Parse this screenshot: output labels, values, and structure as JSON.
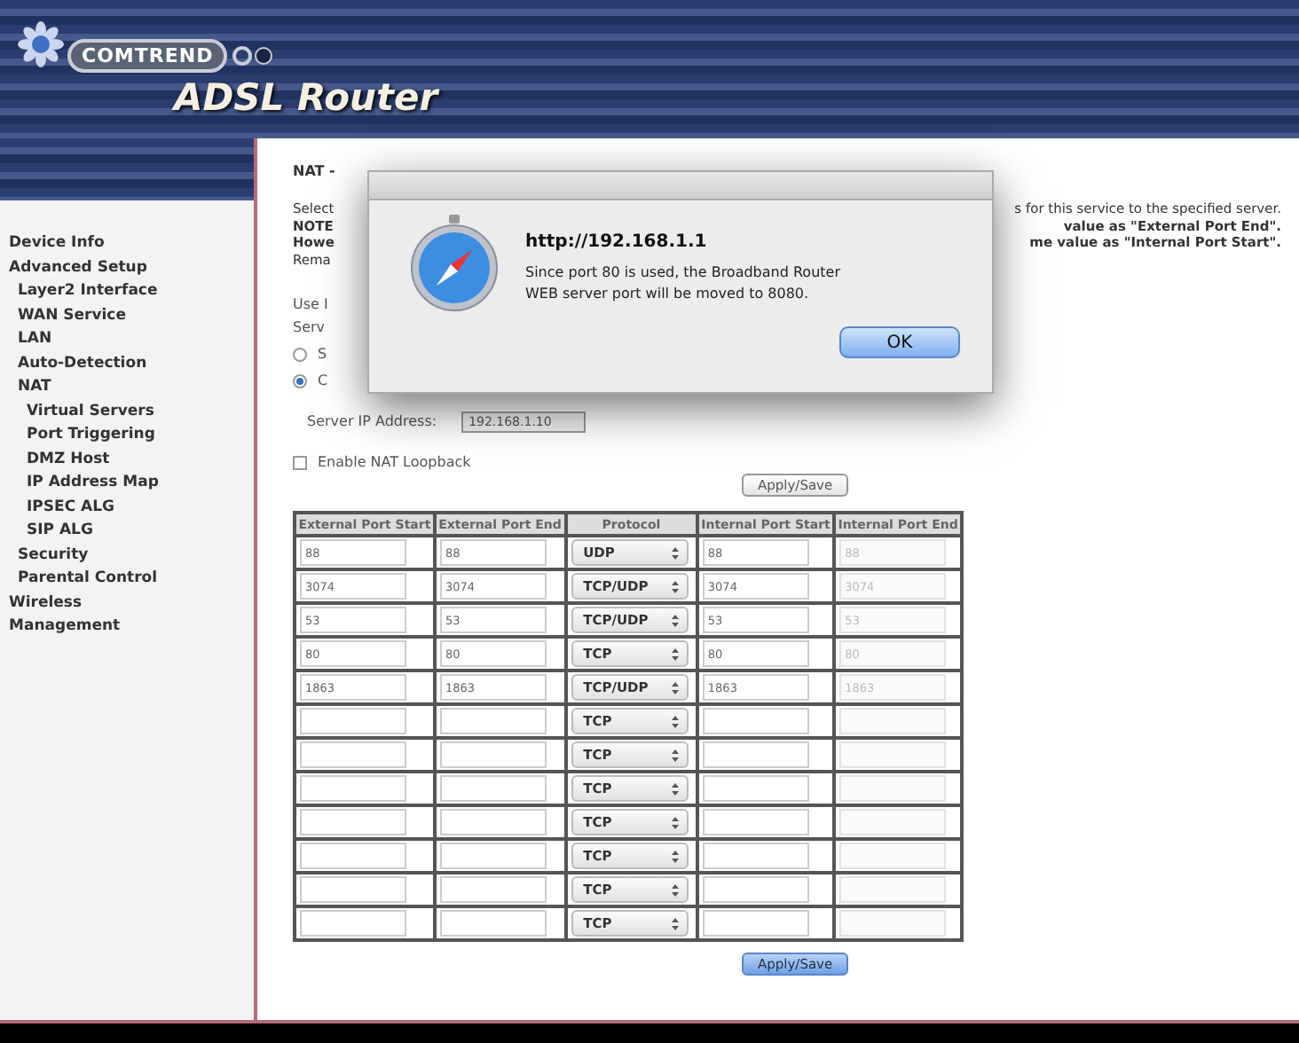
{
  "header": {
    "brand": "COMTREND",
    "product": "ADSL Router"
  },
  "sidebar": {
    "items": [
      {
        "label": "Device Info"
      },
      {
        "label": "Advanced Setup",
        "children": [
          {
            "label": "Layer2 Interface"
          },
          {
            "label": "WAN Service"
          },
          {
            "label": "LAN"
          },
          {
            "label": "Auto-Detection"
          },
          {
            "label": "NAT",
            "children": [
              {
                "label": "Virtual Servers"
              },
              {
                "label": "Port Triggering"
              },
              {
                "label": "DMZ Host"
              },
              {
                "label": "IP Address Map"
              },
              {
                "label": "IPSEC ALG"
              },
              {
                "label": "SIP ALG"
              }
            ]
          },
          {
            "label": "Security"
          },
          {
            "label": "Parental Control"
          }
        ]
      },
      {
        "label": "Wireless"
      },
      {
        "label": "Management"
      }
    ]
  },
  "content": {
    "title": "NAT -",
    "notes": [
      {
        "left": "Select",
        "right": "s for this service to the specified server.",
        "bold": false
      },
      {
        "left": "NOTE",
        "right": "value as \"External Port End\".",
        "bold": true
      },
      {
        "left": "Howe",
        "right": "me value as \"Internal Port Start\".",
        "bold": true
      },
      {
        "left": "Rema",
        "bold": false
      }
    ],
    "use_label": "Use I",
    "service_label": "Serv",
    "radios": [
      {
        "label": "S",
        "selected": false
      },
      {
        "label": "C",
        "selected": true
      }
    ],
    "server_ip_label": "Server IP Address:",
    "server_ip": "192.168.1.10",
    "loopback": {
      "label": "Enable NAT Loopback",
      "checked": false
    },
    "apply_top": {
      "label": "Apply/Save",
      "primary": false
    },
    "apply_bottom": {
      "label": "Apply/Save",
      "primary": true
    }
  },
  "table": {
    "columns": [
      "External Port Start",
      "External Port End",
      "Protocol",
      "Internal Port Start",
      "Internal Port End"
    ],
    "rows": [
      {
        "ext_start": "88",
        "ext_end": "88",
        "protocol": "UDP",
        "int_start": "88",
        "int_end": "88",
        "int_end_disabled": true
      },
      {
        "ext_start": "3074",
        "ext_end": "3074",
        "protocol": "TCP/UDP",
        "int_start": "3074",
        "int_end": "3074",
        "int_end_disabled": true
      },
      {
        "ext_start": "53",
        "ext_end": "53",
        "protocol": "TCP/UDP",
        "int_start": "53",
        "int_end": "53",
        "int_end_disabled": true
      },
      {
        "ext_start": "80",
        "ext_end": "80",
        "protocol": "TCP",
        "int_start": "80",
        "int_end": "80",
        "int_end_disabled": true
      },
      {
        "ext_start": "1863",
        "ext_end": "1863",
        "protocol": "TCP/UDP",
        "int_start": "1863",
        "int_end": "1863",
        "int_end_disabled": true
      },
      {
        "protocol": "TCP",
        "int_end_disabled": true
      },
      {
        "protocol": "TCP",
        "int_end_disabled": true
      },
      {
        "protocol": "TCP",
        "int_end_disabled": true
      },
      {
        "protocol": "TCP",
        "int_end_disabled": true
      },
      {
        "protocol": "TCP",
        "int_end_disabled": true
      },
      {
        "protocol": "TCP",
        "int_end_disabled": true
      },
      {
        "protocol": "TCP",
        "int_end_disabled": true
      }
    ]
  },
  "dialog": {
    "title": "http://192.168.1.1",
    "message": "Since port 80 is used, the Broadband Router WEB server port will be moved to 8080.",
    "ok": "OK"
  }
}
